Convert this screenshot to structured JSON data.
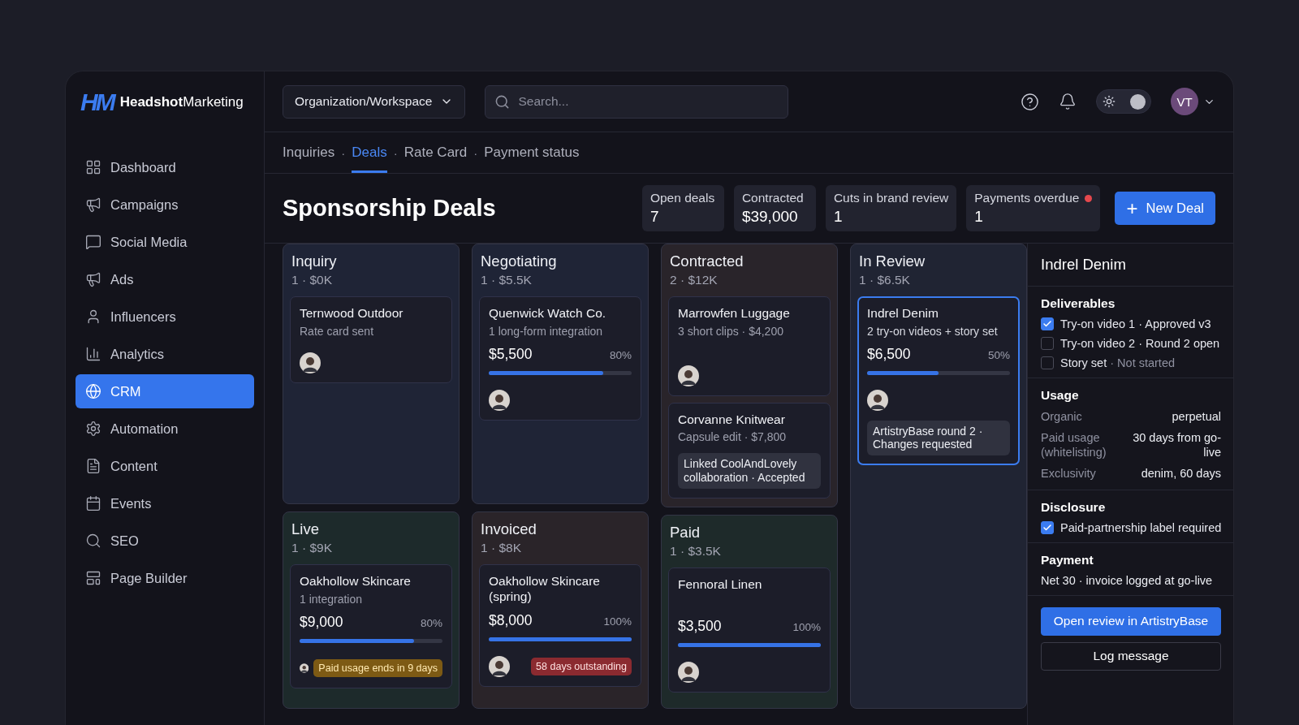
{
  "brand": {
    "mark": "HM",
    "name": "**Headshot**Marketing"
  },
  "nav": [
    {
      "label": "Dashboard",
      "selected": false
    },
    {
      "label": "Campaigns",
      "selected": false
    },
    {
      "label": "Social Media",
      "selected": false
    },
    {
      "label": "Ads",
      "selected": false
    },
    {
      "label": "Influencers",
      "selected": false
    },
    {
      "label": "Analytics",
      "selected": false
    },
    {
      "label": "CRM",
      "selected": true
    },
    {
      "label": "Automation",
      "selected": false
    },
    {
      "label": "Content",
      "selected": false
    },
    {
      "label": "Events",
      "selected": false
    },
    {
      "label": "SEO",
      "selected": false
    },
    {
      "label": "Page Builder",
      "selected": false
    }
  ],
  "topbar": {
    "workspace": "Organization/Workspace",
    "search": {
      "placeholder": "Search..."
    },
    "theme_toggle": {
      "on": true
    },
    "user": {
      "initials": "VT"
    }
  },
  "tabs": {
    "separator": "·",
    "items": [
      {
        "label": "Inquiries",
        "selected": false
      },
      {
        "label": "Deals",
        "selected": true
      },
      {
        "label": "Rate Card",
        "selected": false
      },
      {
        "label": "Payment status",
        "selected": false
      }
    ]
  },
  "page_title": "Sponsorship Deals",
  "stats": [
    {
      "label": "Open deals",
      "value": "7",
      "alert": false
    },
    {
      "label": "Contracted",
      "value": "$39,000",
      "alert": false
    },
    {
      "label": "Cuts in brand review",
      "value": "1",
      "alert": false
    },
    {
      "label": "Payments overdue",
      "value": "1",
      "alert": true
    }
  ],
  "new_button": {
    "plus": "+",
    "label": "New Deal"
  },
  "board": {
    "columns": [
      {
        "stages": [
          {
            "title": "Inquiry",
            "summary": "1 · $0K",
            "color": "#1f2436",
            "cards": [
              {
                "title": "Ternwood Outdoor",
                "subtitle": "Rate card sent",
                "selected": false
              }
            ]
          },
          {
            "title": "Live",
            "summary": "1 · $9K",
            "color": "#1d2a2b",
            "cards": [
              {
                "title": "Oakhollow Skincare",
                "subtitle": "1 integration",
                "amount": "$9,000",
                "percent": "80%",
                "level": 0.8,
                "badge": {
                  "text": "Paid usage ends in 9 days",
                  "kind": "warning"
                },
                "selected": false
              }
            ]
          }
        ]
      },
      {
        "stages": [
          {
            "title": "Negotiating",
            "summary": "1 · $5.5K",
            "color": "#1f2436",
            "cards": [
              {
                "title": "Quenwick Watch Co.",
                "subtitle": "1 long-form integration",
                "amount": "$5,500",
                "percent": "80%",
                "level": 0.8,
                "selected": false
              }
            ]
          },
          {
            "title": "Invoiced",
            "summary": "1 · $8K",
            "color": "#2a2429",
            "cards": [
              {
                "title": "Oakhollow Skincare (spring)",
                "amount": "$8,000",
                "percent": "100%",
                "level": 1,
                "badge": {
                  "text": "58 days outstanding",
                  "kind": "danger"
                },
                "selected": false
              }
            ]
          }
        ]
      },
      {
        "stages": [
          {
            "title": "Contracted",
            "summary": "2 · $12K",
            "color": "#29242a",
            "cards": [
              {
                "title": "Marrowfen Luggage",
                "subtitle": "3 short clips · $4,200",
                "selected": false
              },
              {
                "title": "Corvanne Knitwear",
                "subtitle": "Capsule edit · $7,800",
                "note": "Linked CoolAndLovely collaboration · Accepted",
                "selected": false
              }
            ]
          },
          {
            "title": "Paid",
            "summary": "1 · $3.5K",
            "color": "#1e2a2a",
            "cards": [
              {
                "title": "Fennoral Linen",
                "amount": "$3,500",
                "percent": "100%",
                "level": 1,
                "selected": false
              }
            ]
          }
        ]
      },
      {
        "stages": [
          {
            "title": "In Review",
            "summary": "1 · $6.5K",
            "color": "#202433",
            "cards": [
              {
                "title": "Indrel Denim",
                "subtitle": "2 try-on videos + story set",
                "amount": "$6,500",
                "percent": "50%",
                "level": 0.5,
                "note": "ArtistryBase round 2 · Changes requested",
                "selected": true
              }
            ]
          }
        ]
      }
    ]
  },
  "detail": {
    "title": "Indrel Denim",
    "deliverables": {
      "heading": "Deliverables",
      "items": [
        {
          "label": "Try-on video 1",
          "status": "· Approved v3",
          "checked": true,
          "dimmed": false
        },
        {
          "label": "Try-on video 2",
          "status": "· Round 2 open",
          "checked": false,
          "dimmed": false
        },
        {
          "label": "Story set",
          "status": "· Not started",
          "checked": false,
          "dimmed": true
        }
      ]
    },
    "usage": {
      "heading": "Usage",
      "rows": [
        {
          "key": "Organic",
          "value": "perpetual"
        },
        {
          "key": "Paid usage (whitelisting)",
          "value": "30 days from go-live"
        },
        {
          "key": "Exclusivity",
          "value": "denim, 60 days"
        }
      ]
    },
    "disclosure": {
      "heading": "Disclosure",
      "items": [
        {
          "label": "Paid-partnership label required",
          "checked": true
        }
      ]
    },
    "payment": {
      "heading": "Payment",
      "text": "Net 30 · invoice logged at go-live"
    },
    "buttons": [
      {
        "label": "Open review in ArtistryBase",
        "kind": "primary"
      },
      {
        "label": "Log message",
        "kind": "secondary"
      }
    ]
  }
}
